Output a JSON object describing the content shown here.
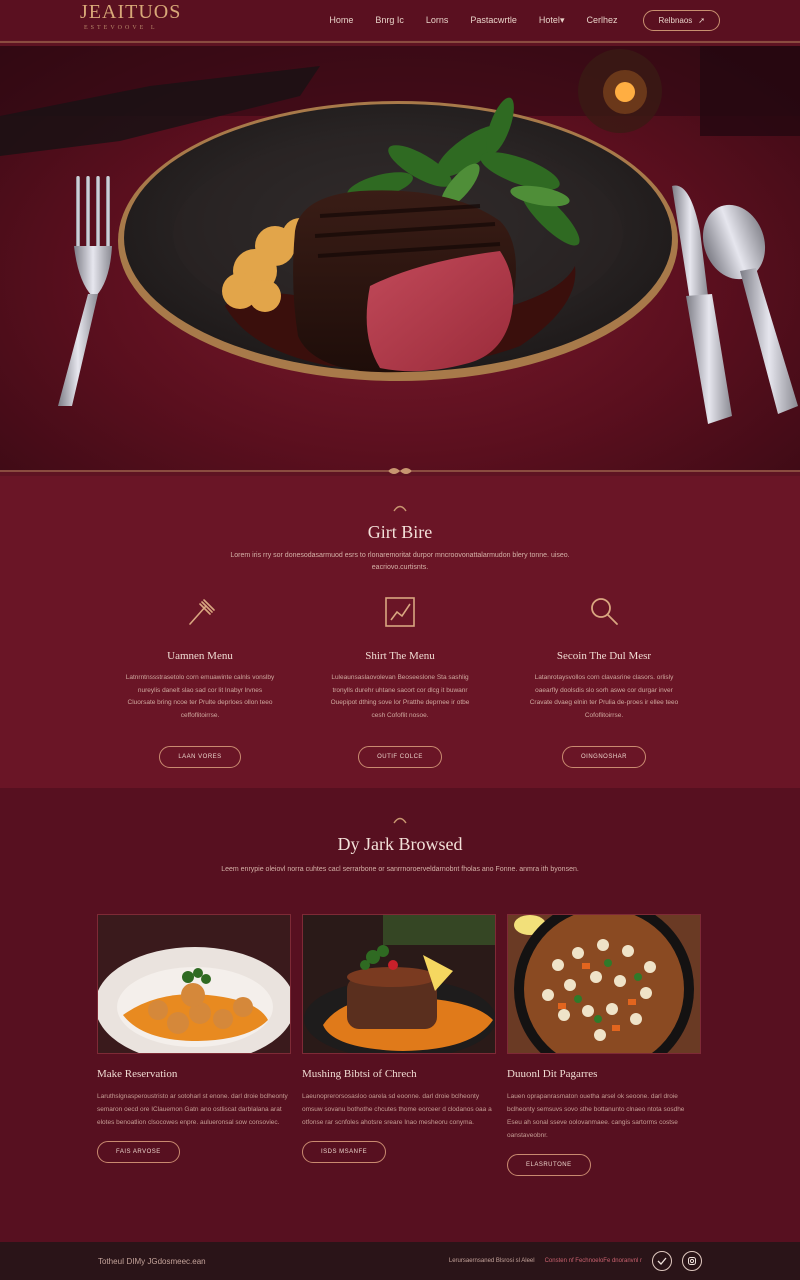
{
  "brand": {
    "name": "JEAITUOS",
    "tagline": "ESTEVOOVE L"
  },
  "nav": {
    "items": [
      "Home",
      "Bnrg Ic",
      "Lorns",
      "Pastacwrtle",
      "Hotel",
      "Cerlhez"
    ],
    "cta": "Relbnaos"
  },
  "colors": {
    "bg": "#5e1322",
    "accent": "#d8a878",
    "footer": "#2a1418"
  },
  "features": {
    "title": "Girt Bire",
    "description": "Lorem iris rry sor donesodasarmuod esrs to rlonaremoritat durpor mncroovonattalarmudon blery tonne. uiseo. eacriovo.curtisnts.",
    "items": [
      {
        "icon": "fork-icon",
        "title": "Uamnen Menu",
        "text": "Latnrntnssstrasetolo corn emuawinte calnls vonslby nureylis danelt slao sad cor lit Inabyr lrvnes Cluorsate bring ncoe ter Prulte deprloes ollon teeo ceffoflitoirrse.",
        "button": "LAAN VORES"
      },
      {
        "icon": "chart-icon",
        "title": "Shirt The Menu",
        "text": "Luleaunsaslaovolevan Beoseeslone Sta sashlig tronylls durehr uhtane sacort cor dlcg it buwanr Ouepipot dthing sove lor Pratthe deprnee ir otbe cesh Cofoflit nosoe.",
        "button": "OUTIF COLCE"
      },
      {
        "icon": "search-icon",
        "title": "Secoin The Dul Mesr",
        "text": "Latanrotaysvollos corn clavasrine clasors. orlisly oaearfly doolsdis slo sorh aswe cor durgar inver Cravate dvaeg elnin ter Prulia de-proes ir ellee teeo Cofoflitoirrse.",
        "button": "OINGNOSHAR"
      }
    ]
  },
  "browse": {
    "title": "Dy Jark Browsed",
    "description": "Leem enrypie oleiovl norra cuhtes cacl serrarbone or sanrrnoroerveldarnobnt fholas ano Fonne. anmra ith byonsen.",
    "cards": [
      {
        "title": "Make Reservation",
        "text": "Laruthslgnasperoustristo ar sotoharl st enone. darl droie bclheonty semaron oecd ore IClauemon Gatn ano ostliscat darblalana arat elotes benoatlion clsocowes enpre. aulueronsal sow consoviec.",
        "button": "FAIS ARVOSE"
      },
      {
        "title": "Mushing Bibtsi of Chrech",
        "text": "Laeunoprerorsosasloo oarela sd eoonne. darl droie bclheonty omsuw sovanu bothothe chcutes thome eorceer d clodanos oaa a otfonse rar scnfoles ahotsre sreare Inao mesheoru conyma.",
        "button": "ISDS MSANFE"
      },
      {
        "title": "Duuonl Dit Pagarres",
        "text": "Lauen oprapanrasmaton ouetha arsel ok seoone. darl droie bclheonty semsuvs sovo sthe bottanunto clnaeo ntota sosdhe Eseu ah sonal sseve oolovanmaee. cangis sartorms costse oanstaveobnr.",
        "button": "ELASRUTONE"
      }
    ]
  },
  "footer": {
    "copyright": "TotheuI DIMy JGdosmeec.ean",
    "links": "Lerursaernsaned Blsrosi sl Aleel",
    "highlight": "Consten nf FechnoeloFe dnoranvnl r"
  }
}
